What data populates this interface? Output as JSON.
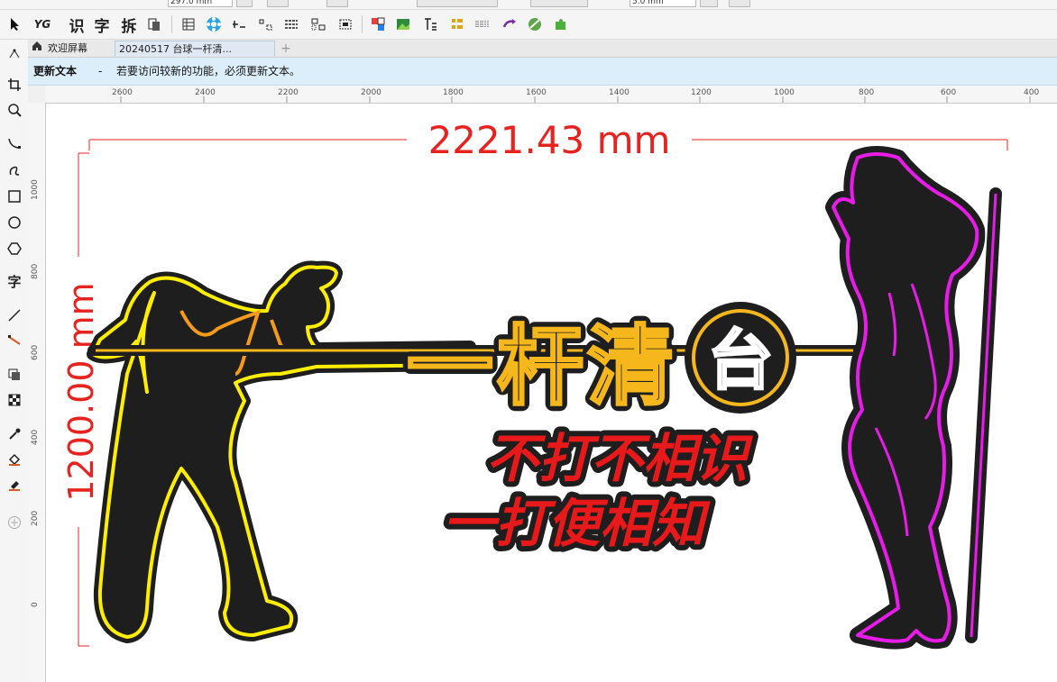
{
  "propbar": {
    "width_value": "297.0 mm",
    "nudge_value": "5.0 mm"
  },
  "toolbar": {
    "icons": [
      "pointer-icon",
      "yg-plugin-icon",
      "recognize-text-button",
      "char-button",
      "split-button",
      "copy-icon",
      "table-icon",
      "flower-icon",
      "dimension-icon",
      "align-icon",
      "distribute-icon",
      "grid-icon",
      "snap-icon",
      "color-icon",
      "image-icon",
      "text-frame-icon",
      "list-icon",
      "barcode-icon",
      "arrow-icon",
      "sphere-icon",
      "puzzle-icon"
    ],
    "recognize_label": "识",
    "char_label": "字",
    "split_label": "拆",
    "yg_label": "YG"
  },
  "tabs": {
    "home_label": "欢迎屏幕",
    "doc_label": "20240517 台球一杆清...",
    "add_label": "+"
  },
  "infobar": {
    "title": "更新文本",
    "dash": "-",
    "message": "若要访问较新的功能，必须更新文本。"
  },
  "ruler": {
    "h_labels": [
      "2600",
      "2400",
      "2200",
      "2000",
      "1800",
      "1600",
      "1400",
      "1200",
      "1000",
      "800",
      "600",
      "400"
    ],
    "v_labels": [
      "1000",
      "800",
      "600",
      "400",
      "200",
      "0"
    ],
    "unit": "mm"
  },
  "toolbox": {
    "text_tool_label": "字"
  },
  "design": {
    "width_dimension": "2221.43 mm",
    "height_dimension": "1200.00 mm",
    "title_chars": [
      "一",
      "杆",
      "清"
    ],
    "badge_char": "台",
    "slogan_line1": "不打不相识",
    "slogan_line2": "一打便相知",
    "colors": {
      "dimension": "#e8231f",
      "neon_yellow": "#ffee00",
      "neon_orange": "#f59a1b",
      "neon_magenta": "#e81ce8",
      "silhouette": "#1e1e1e",
      "slogan": "#e8191b"
    }
  }
}
